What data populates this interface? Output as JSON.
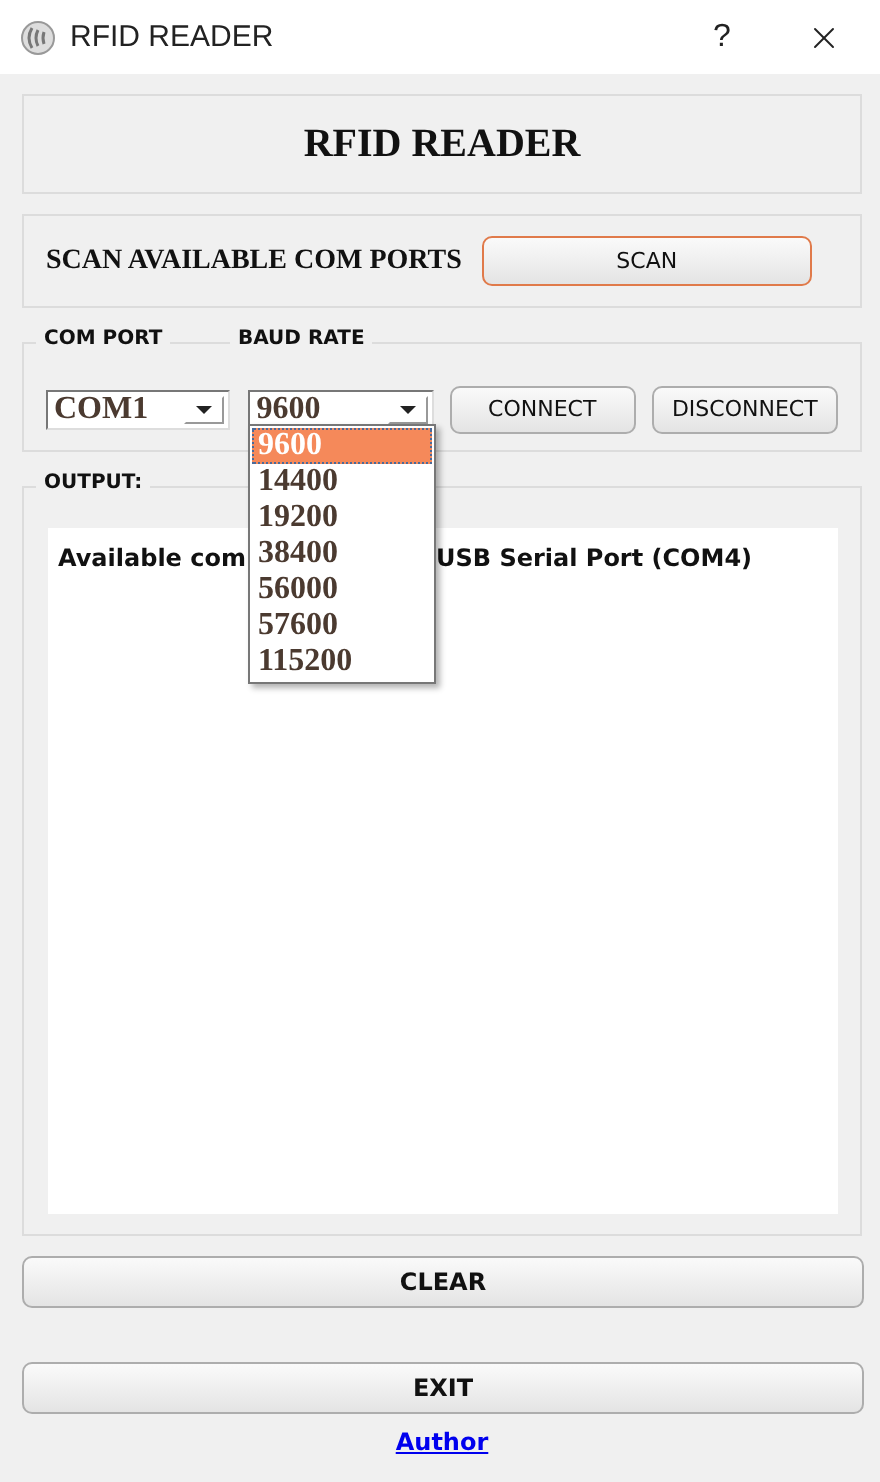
{
  "window": {
    "title": "RFID READER",
    "help": "?"
  },
  "header": {
    "title": "RFID READER"
  },
  "scan": {
    "label": "SCAN AVAILABLE COM PORTS",
    "button": "SCAN"
  },
  "connection": {
    "com_port": {
      "label": "COM PORT",
      "value": "COM1"
    },
    "baud_rate": {
      "label": "BAUD RATE",
      "value": "9600",
      "expanded": true,
      "options": [
        {
          "label": "9600",
          "selected": true
        },
        {
          "label": "14400",
          "selected": false
        },
        {
          "label": "19200",
          "selected": false
        },
        {
          "label": "38400",
          "selected": false
        },
        {
          "label": "56000",
          "selected": false
        },
        {
          "label": "57600",
          "selected": false
        },
        {
          "label": "115200",
          "selected": false
        }
      ]
    },
    "buttons": [
      "CONNECT",
      "DISCONNECT"
    ]
  },
  "output": {
    "label": "OUTPUT:",
    "text_visible_parts": [
      "Available com",
      "USB Serial Port (COM4)"
    ]
  },
  "buttons": [
    "CLEAR",
    "EXIT"
  ],
  "link": "Author"
}
